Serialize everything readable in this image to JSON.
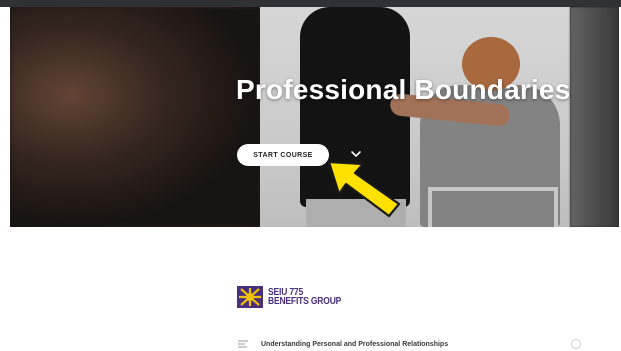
{
  "hero": {
    "title": "Professional Boundaries",
    "start_button_label": "START COURSE",
    "scroll_icon": "chevron-down-icon"
  },
  "brand": {
    "line1": "SEIU 775",
    "line2": "BENEFITS GROUP",
    "logo_icon": "sunburst-logo-icon",
    "logo_colors": [
      "#f2c200",
      "#4a2f7c"
    ]
  },
  "lessons": [
    {
      "title": "Understanding Personal and Professional Relationships",
      "icon": "lesson-text-icon",
      "status_icon": "incomplete-circle-icon"
    }
  ],
  "annotation": {
    "icon": "yellow-pointer-arrow-icon",
    "color": "#ffe100"
  }
}
